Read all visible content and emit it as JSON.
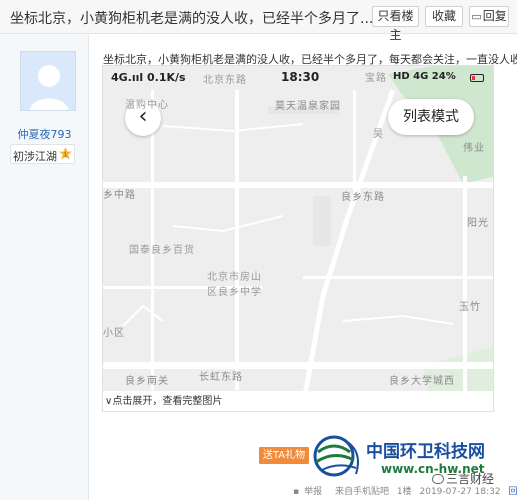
{
  "header": {
    "title": "坐标北京，小黄狗柜机老是满的没人收，已经半个多月了...",
    "buttons": {
      "only_louzhu": "只看楼主",
      "favorite": "收藏",
      "reply": "回复"
    }
  },
  "user": {
    "louzhu_tag": "楼主",
    "name": "仲夏夜793",
    "level": "初涉江湖"
  },
  "post": {
    "text": "坐标北京，小黄狗柜机老是满的没人收，已经半个多月了，每天都会关注，一直没人收"
  },
  "map": {
    "status": {
      "left": "4G.ııl  0.1K/s",
      "time": "18:30",
      "right": "HD 4G  24%"
    },
    "back_button": "‹",
    "list_mode": "列表模式",
    "labels": {
      "l1": "北京东路",
      "l2": "宝路",
      "l3": "温购中心",
      "l4": "莫天温泉家园",
      "l5": "昊",
      "l6": "伟业",
      "l7": "乡中路",
      "l8": "良乡东路",
      "l9": "阳光",
      "l10": "国泰良乡百货",
      "l11": "北京市房山",
      "l12": "区良乡中学",
      "l13": "玉竹",
      "l14": "小区",
      "l15": "良乡南关",
      "l16": "长虹东路",
      "l17": "良乡大学城西"
    },
    "expand_text": "∨点击展开，查看完整图片"
  },
  "gift_button": "送TA礼物",
  "footer": {
    "report": "举报",
    "source": "来自手机贴吧",
    "floor": "1楼",
    "time": "2019-07-27 18:32",
    "reply": "回复"
  },
  "watermark": {
    "title": "中国环卫科技网",
    "url": "www.cn-hw.net",
    "wechat": "三言财经"
  },
  "colors": {
    "link": "#2d64b3",
    "gift": "#f08b3c",
    "watermark_blue": "#1a4fa0",
    "watermark_green": "#1f7a3e"
  }
}
